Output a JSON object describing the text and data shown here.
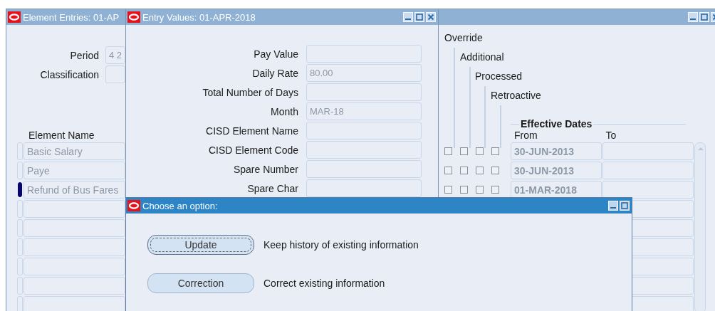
{
  "element_entries_window": {
    "title": "Element Entries: 01-AP",
    "period": {
      "label": "Period",
      "value": "4 2"
    },
    "classification": {
      "label": "Classification"
    },
    "element_name_header": "Element Name",
    "flag_columns": [
      "Override",
      "Additional",
      "Processed",
      "Retroactive"
    ],
    "effective_dates": {
      "title": "Effective Dates",
      "from": "From",
      "to": "To"
    },
    "rows": [
      {
        "element": "Basic Salary",
        "checks": [
          false,
          false,
          false,
          false
        ],
        "from": "30-JUN-2013",
        "selected": false
      },
      {
        "element": "Paye",
        "checks": [
          false,
          false,
          false,
          false
        ],
        "from": "30-JUN-2013",
        "selected": false
      },
      {
        "element": "Refund of Bus Fares",
        "checks": [
          false,
          false,
          false,
          false
        ],
        "from": "01-MAR-2018",
        "selected": true
      },
      {
        "selected": false
      },
      {
        "selected": false
      },
      {
        "selected": false
      },
      {
        "selected": false
      },
      {
        "selected": false
      },
      {
        "selected": false
      }
    ]
  },
  "entry_values_window": {
    "title": "Entry Values: 01-APR-2018",
    "fields": [
      {
        "label": "Pay Value"
      },
      {
        "label": "Daily Rate",
        "value": "80.00"
      },
      {
        "label": "Total Number of Days"
      },
      {
        "label": "Month",
        "value": "MAR-18"
      },
      {
        "label": "CISD Element Name"
      },
      {
        "label": "CISD Element Code"
      },
      {
        "label": "Spare Number"
      },
      {
        "label": "Spare Char"
      }
    ]
  },
  "dialog": {
    "title": "Choose an option:",
    "options": [
      {
        "button": "Update",
        "description": "Keep history of existing information",
        "focused": true
      },
      {
        "button": "Correction",
        "description": "Correct existing information",
        "focused": false
      }
    ]
  }
}
